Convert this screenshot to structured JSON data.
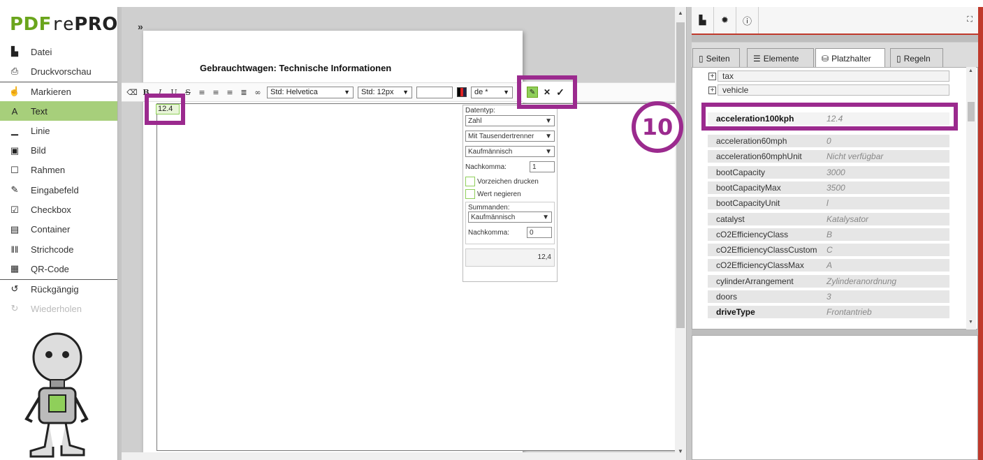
{
  "app": {
    "logo_part1": "PDF",
    "logo_part2": "re",
    "logo_part3": "PRO"
  },
  "sidebar": {
    "items": [
      {
        "label": "Datei",
        "icon": "file-icon",
        "glyph": "▙"
      },
      {
        "label": "Druckvorschau",
        "icon": "printer-icon",
        "glyph": "⎙"
      },
      {
        "label": "Markieren",
        "icon": "pointer-icon",
        "glyph": "☝"
      },
      {
        "label": "Text",
        "icon": "text-icon",
        "glyph": "A"
      },
      {
        "label": "Linie",
        "icon": "line-icon",
        "glyph": "▁"
      },
      {
        "label": "Bild",
        "icon": "image-icon",
        "glyph": "▣"
      },
      {
        "label": "Rahmen",
        "icon": "frame-icon",
        "glyph": "☐"
      },
      {
        "label": "Eingabefeld",
        "icon": "input-field-icon",
        "glyph": "✎"
      },
      {
        "label": "Checkbox",
        "icon": "checkbox-icon",
        "glyph": "☑"
      },
      {
        "label": "Container",
        "icon": "container-icon",
        "glyph": "▤"
      },
      {
        "label": "Strichcode",
        "icon": "barcode-icon",
        "glyph": "‖‖"
      },
      {
        "label": "QR-Code",
        "icon": "qr-code-icon",
        "glyph": "▦"
      },
      {
        "label": "Rückgängig",
        "icon": "undo-icon",
        "glyph": "↺"
      },
      {
        "label": "Wiederholen",
        "icon": "redo-icon",
        "glyph": "↻"
      }
    ]
  },
  "editor": {
    "collapse_glyph": "»",
    "page_title": "Gebrauchtwagen: Technische Informationen",
    "field_value": "12.4",
    "toolbar": {
      "font_family": "Std: Helvetica",
      "font_size": "Std: 12px",
      "locale": "de *"
    }
  },
  "format_panel": {
    "datatype_label": "Datentyp:",
    "datatype_value": "Zahl",
    "thousands_value": "Mit Tausendertrenner",
    "rounding_value": "Kaufmännisch",
    "decimals_label": "Nachkomma:",
    "decimals_value": "1",
    "sign_label": "Vorzeichen drucken",
    "negate_label": "Wert negieren",
    "summands_label": "Summanden:",
    "summands_rounding": "Kaufmännisch",
    "summands_decimals_label": "Nachkomma:",
    "summands_decimals_value": "0",
    "preview_value": "12,4"
  },
  "right_panel": {
    "tabs": [
      {
        "label": "Seiten",
        "icon": "page-icon"
      },
      {
        "label": "Elemente",
        "icon": "list-icon"
      },
      {
        "label": "Platzhalter",
        "icon": "database-icon"
      },
      {
        "label": "Regeln",
        "icon": "rules-icon"
      }
    ],
    "tree": [
      {
        "label": "tax"
      },
      {
        "label": "vehicle"
      }
    ],
    "properties": [
      {
        "key": "acceleration100kph",
        "value": "12.4",
        "bold": true
      },
      {
        "key": "acceleration60mph",
        "value": "0"
      },
      {
        "key": "acceleration60mphUnit",
        "value": "Nicht verfügbar"
      },
      {
        "key": "bootCapacity",
        "value": "3000"
      },
      {
        "key": "bootCapacityMax",
        "value": "3500"
      },
      {
        "key": "bootCapacityUnit",
        "value": "l"
      },
      {
        "key": "catalyst",
        "value": "Katalysator"
      },
      {
        "key": "cO2EfficiencyClass",
        "value": "B"
      },
      {
        "key": "cO2EfficiencyClassCustom",
        "value": "C"
      },
      {
        "key": "cO2EfficiencyClassMax",
        "value": "A"
      },
      {
        "key": "cylinderArrangement",
        "value": "Zylinderanordnung"
      },
      {
        "key": "doors",
        "value": "3"
      },
      {
        "key": "driveType",
        "value": "Frontantrieb",
        "bold": true
      }
    ]
  },
  "annotation": {
    "step_number": "10",
    "color": "#9b2a8e"
  },
  "colors": {
    "accent_green": "#a7cf7b",
    "logo_green": "#6aa51c",
    "highlight_purple": "#9b2a8e"
  }
}
